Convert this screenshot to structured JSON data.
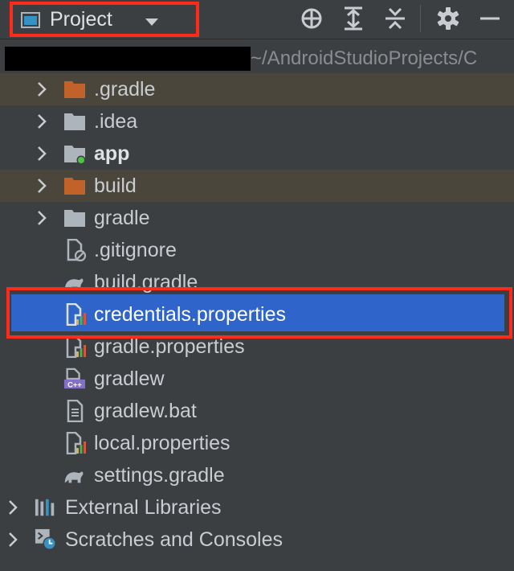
{
  "header": {
    "title": "Project",
    "tools": [
      "locate-icon",
      "expand-all-icon",
      "collapse-all-icon",
      "gear-icon",
      "minimize-icon"
    ]
  },
  "path": {
    "suffix": "~/AndroidStudioProjects/C"
  },
  "tree": {
    "items": [
      {
        "label": ".gradle",
        "icon": "folder-excluded-icon"
      },
      {
        "label": ".idea",
        "icon": "folder-icon"
      },
      {
        "label": "app",
        "icon": "module-folder-icon"
      },
      {
        "label": "build",
        "icon": "folder-excluded-icon"
      },
      {
        "label": "gradle",
        "icon": "folder-icon"
      },
      {
        "label": ".gitignore",
        "icon": "ignore-file-icon"
      },
      {
        "label": "build.gradle",
        "icon": "gradle-elephant-icon"
      },
      {
        "label": "credentials.properties",
        "icon": "properties-file-icon",
        "selected": true
      },
      {
        "label": "gradle.properties",
        "icon": "properties-file-icon"
      },
      {
        "label": "gradlew",
        "icon": "cpp-file-icon"
      },
      {
        "label": "gradlew.bat",
        "icon": "text-file-icon"
      },
      {
        "label": "local.properties",
        "icon": "properties-file-icon"
      },
      {
        "label": "settings.gradle",
        "icon": "gradle-elephant-icon"
      }
    ],
    "roots": [
      {
        "label": "External Libraries",
        "icon": "libraries-icon"
      },
      {
        "label": "Scratches and Consoles",
        "icon": "scratches-icon"
      }
    ]
  },
  "colors": {
    "background": "#3c3f41",
    "selection": "#2f65ca",
    "highlight_border": "#ff2a1a",
    "excluded_row": "#4b463c",
    "excluded_folder": "#c2622b",
    "folder": "#aeb4bb"
  }
}
